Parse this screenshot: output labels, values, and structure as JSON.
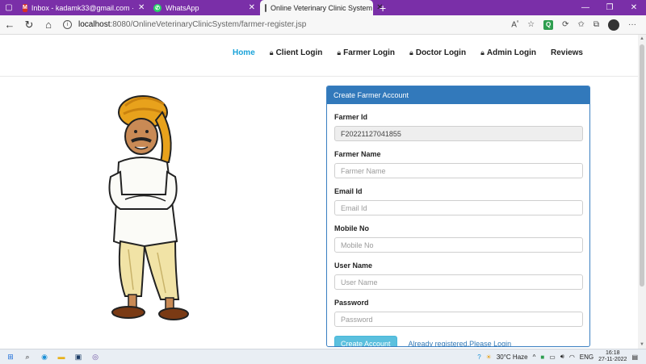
{
  "browser": {
    "tabs": [
      {
        "title": "Inbox - kadamk33@gmail.com ·",
        "icon": "gmail-icon"
      },
      {
        "title": "WhatsApp",
        "icon": "whatsapp-icon"
      },
      {
        "title": "Online Veterinary Clinic System",
        "icon": "page-icon",
        "active": true
      }
    ],
    "url_host": "localhost",
    "url_path": ":8080/OnlineVeterinaryClinicSystem/farmer-register.jsp",
    "read_aloud": "A"
  },
  "nav": {
    "items": [
      {
        "label": "Home",
        "active": true,
        "lock": false
      },
      {
        "label": "Client Login",
        "lock": true
      },
      {
        "label": "Farmer Login",
        "lock": true
      },
      {
        "label": "Doctor Login",
        "lock": true
      },
      {
        "label": "Admin Login",
        "lock": true
      },
      {
        "label": "Reviews",
        "lock": false
      }
    ]
  },
  "form": {
    "title": "Create Farmer Account",
    "farmer_id_label": "Farmer Id",
    "farmer_id_value": "F20221127041855",
    "farmer_name_label": "Farmer Name",
    "farmer_name_placeholder": "Farmer Name",
    "email_label": "Email Id",
    "email_placeholder": "Email Id",
    "mobile_label": "Mobile No",
    "mobile_placeholder": "Mobile No",
    "username_label": "User Name",
    "username_placeholder": "User Name",
    "password_label": "Password",
    "password_placeholder": "Password",
    "submit_label": "Create Account",
    "login_link": "Already registered,Please Login"
  },
  "taskbar": {
    "weather": "30°C  Haze",
    "lang": "ENG",
    "time": "16:18",
    "date": "27-11-2022"
  },
  "colors": {
    "accent": "#1aa3d9",
    "panel_header": "#3279bb",
    "button": "#5bc0de",
    "tab_strip": "#7a2fa8"
  }
}
